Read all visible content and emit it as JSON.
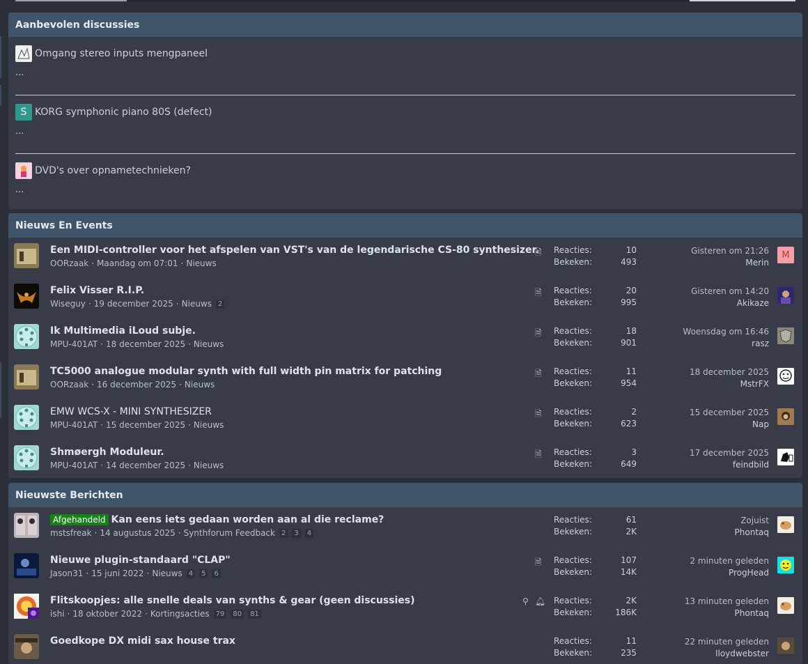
{
  "featured": {
    "heading": "Aanbevolen discussies",
    "items": [
      {
        "title": "Omgang stereo inputs mengpaneel",
        "snippet": "...",
        "avatar_letter": ""
      },
      {
        "title": "KORG symphonic piano 80S (defect)",
        "snippet": "...",
        "avatar_letter": "S"
      },
      {
        "title": "DVD's over opnametechnieken?",
        "snippet": "...",
        "avatar_letter": ""
      }
    ]
  },
  "labels": {
    "replies": "Reacties:",
    "views": "Bekeken:"
  },
  "news": {
    "heading": "Nieuws En Events",
    "rows": [
      {
        "title": "Een MIDI-controller voor het afspelen van VST's van de legendarische CS-80 synthesizer.",
        "author": "OORzaak",
        "date": "Maandag om 07:01",
        "forum": "Nieuws",
        "pages": [],
        "replies": "10",
        "views": "493",
        "last_time": "Gisteren om 21:26",
        "last_user": "Merin",
        "last_av_letter": "M"
      },
      {
        "title": "Felix Visser R.I.P.",
        "author": "Wiseguy",
        "date": "19 december 2025",
        "forum": "Nieuws",
        "pages": [
          "2"
        ],
        "replies": "20",
        "views": "995",
        "last_time": "Gisteren om 14:20",
        "last_user": "Akikaze",
        "last_av_letter": ""
      },
      {
        "title": "Ik Multimedia iLoud subje.",
        "author": "MPU-401AT",
        "date": "18 december 2025",
        "forum": "Nieuws",
        "pages": [],
        "replies": "18",
        "views": "901",
        "last_time": "Woensdag om 16:46",
        "last_user": "rasz",
        "last_av_letter": ""
      },
      {
        "title": "TC5000 analogue modular synth with full width pin matrix for patching",
        "author": "OORzaak",
        "date": "16 december 2025",
        "forum": "Nieuws",
        "pages": [],
        "replies": "11",
        "views": "954",
        "last_time": "18 december 2025",
        "last_user": "MstrFX",
        "last_av_letter": ""
      },
      {
        "title": "EMW WCS-X - MINI SYNTHESIZER",
        "author": "MPU-401AT",
        "date": "15 december 2025",
        "forum": "Nieuws",
        "pages": [],
        "replies": "2",
        "views": "623",
        "last_time": "15 december 2025",
        "last_user": "Nap",
        "last_av_letter": ""
      },
      {
        "title": "Shmøergh Moduleur.",
        "author": "MPU-401AT",
        "date": "14 december 2025",
        "forum": "Nieuws",
        "pages": [],
        "replies": "3",
        "views": "649",
        "last_time": "17 december 2025",
        "last_user": "feindbild",
        "last_av_letter": ""
      }
    ]
  },
  "latest": {
    "heading": "Nieuwste Berichten",
    "rows": [
      {
        "prefix": "Afgehandeld",
        "title": "Kan eens iets gedaan worden aan al die reclame?",
        "author": "mstsfreak",
        "date": "14 augustus 2025",
        "forum": "Synthforum Feedback",
        "pages": [
          "2",
          "3",
          "4"
        ],
        "replies": "61",
        "views": "2K",
        "last_time": "Zojuist",
        "last_user": "Phontaq"
      },
      {
        "prefix": "",
        "title": "Nieuwe plugin-standaard \"CLAP\"",
        "author": "Jason31",
        "date": "15 juni 2022",
        "forum": "Nieuws",
        "pages": [
          "4",
          "5",
          "6"
        ],
        "replies": "107",
        "views": "14K",
        "last_time": "2 minuten geleden",
        "last_user": "ProgHead"
      },
      {
        "prefix": "",
        "title": "Flitskoopjes: alle snelle deals van synths & gear (geen discussies)",
        "author": "ishi",
        "date": "18 oktober 2022",
        "forum": "Kortingsacties",
        "pages": [
          "79",
          "80",
          "81"
        ],
        "replies": "2K",
        "views": "186K",
        "last_time": "13 minuten geleden",
        "last_user": "Phontaq"
      },
      {
        "prefix": "",
        "title": "Goedkope DX midi sax house trax",
        "author": "",
        "date": "",
        "forum": "",
        "pages": [],
        "replies": "11",
        "views": "235",
        "last_time": "22 minuten geleden",
        "last_user": "lloydwebster"
      }
    ]
  }
}
